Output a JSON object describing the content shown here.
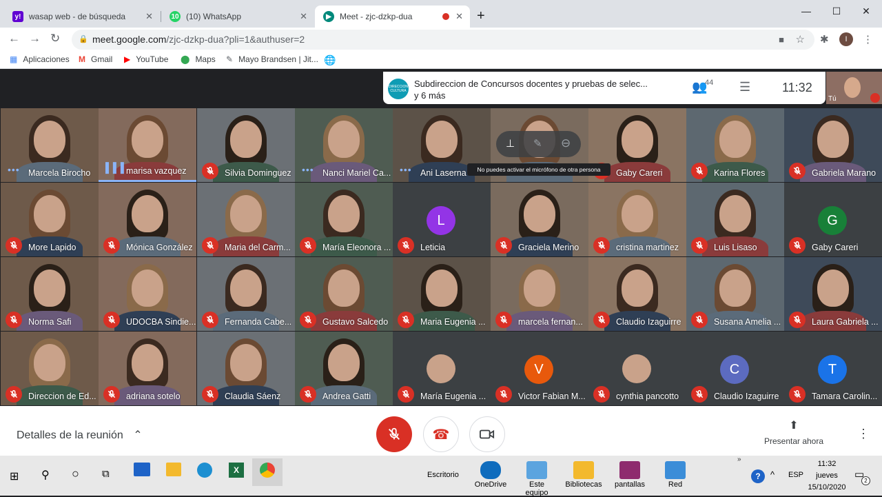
{
  "browser": {
    "tabs": [
      {
        "label": "wasap web - de búsqueda",
        "icon": "yahoo-icon"
      },
      {
        "label": "(10) WhatsApp",
        "icon": "whatsapp-icon"
      },
      {
        "label": "Meet - zjc-dzkp-dua",
        "icon": "meet-icon",
        "active": true
      }
    ],
    "url_main": "meet.google.com",
    "url_rest": "/zjc-dzkp-dua?pli=1&authuser=2",
    "profile_initial": "I",
    "bookmarks": [
      "Aplicaciones",
      "Gmail",
      "YouTube",
      "Maps",
      "Mayo Brandsen | Jit..."
    ]
  },
  "meeting": {
    "presenter_logo": "DIRECCION CULTURA",
    "title_line1": "Subdireccion de Concursos docentes y pruebas de selec...",
    "title_line2": "y 6 más",
    "participants_count": "44",
    "time": "11:32",
    "self_label": "Tú",
    "mic_tooltip": "No puedes activar el micrófono de otra persona",
    "colors": {
      "mute_red": "#d93025",
      "meet_bg": "#202124"
    }
  },
  "participants": [
    {
      "name": "Marcela Birocho",
      "status": "speaking"
    },
    {
      "name": "marisa vazquez",
      "status": "active"
    },
    {
      "name": "Silvia Dominguez",
      "status": "muted"
    },
    {
      "name": "Nanci Mariel Ca...",
      "status": "speaking"
    },
    {
      "name": "Ani Laserna",
      "status": "speaking"
    },
    {
      "name": "",
      "status": "hover"
    },
    {
      "name": "Gaby Careri",
      "status": "muted"
    },
    {
      "name": "Karina Flores",
      "status": "muted"
    },
    {
      "name": "Gabriela Marano",
      "status": "muted"
    },
    {
      "name": "More Lapido",
      "status": "muted"
    },
    {
      "name": "Mónica González",
      "status": "muted"
    },
    {
      "name": "Maria del Carm...",
      "status": "muted"
    },
    {
      "name": "María Eleonora ...",
      "status": "muted"
    },
    {
      "name": "Leticia",
      "status": "muted",
      "avatar": "L",
      "avatar_color": "#9334e6"
    },
    {
      "name": "Graciela Merino",
      "status": "muted"
    },
    {
      "name": "cristina martinez",
      "status": "muted"
    },
    {
      "name": "Luis Lisaso",
      "status": "muted"
    },
    {
      "name": "Gaby Careri",
      "status": "muted",
      "avatar": "G",
      "avatar_color": "#188038"
    },
    {
      "name": "Norma Safi",
      "status": "muted"
    },
    {
      "name": "UDOCBA Sindie...",
      "status": "muted"
    },
    {
      "name": "Fernanda Cabe...",
      "status": "muted"
    },
    {
      "name": "Gustavo Salcedo",
      "status": "muted"
    },
    {
      "name": "Maria Eugenia ...",
      "status": "muted"
    },
    {
      "name": "marcela fernan...",
      "status": "muted"
    },
    {
      "name": "Claudio Izaguirre",
      "status": "muted"
    },
    {
      "name": "Susana Amelia ...",
      "status": "muted"
    },
    {
      "name": "Laura Gabriela ...",
      "status": "muted"
    },
    {
      "name": "Direccion de Ed...",
      "status": "muted"
    },
    {
      "name": "adriana sotelo",
      "status": "muted"
    },
    {
      "name": "Claudia Sáenz",
      "status": "muted"
    },
    {
      "name": "Andrea Gatti",
      "status": "muted"
    },
    {
      "name": "María Eugenia ...",
      "status": "muted",
      "avatar": "photo"
    },
    {
      "name": "Victor Fabian M...",
      "status": "muted",
      "avatar": "V",
      "avatar_color": "#e8590c"
    },
    {
      "name": "cynthia pancotto",
      "status": "muted",
      "avatar": "photo"
    },
    {
      "name": "Claudio Izaguirre",
      "status": "muted",
      "avatar": "C",
      "avatar_color": "#5c6bc0"
    },
    {
      "name": "Tamara Carolin...",
      "status": "muted",
      "avatar": "T",
      "avatar_color": "#1a73e8"
    }
  ],
  "bottom_bar": {
    "details_label": "Detalles de la reunión",
    "present_label": "Presentar ahora"
  },
  "taskbar": {
    "items": [
      "Escritorio",
      "OneDrive",
      "Este equipo",
      "Bibliotecas",
      "pantallas",
      "Red"
    ],
    "lang": "ESP",
    "time": "11:32",
    "day": "jueves",
    "date": "15/10/2020",
    "notifications": "2"
  }
}
